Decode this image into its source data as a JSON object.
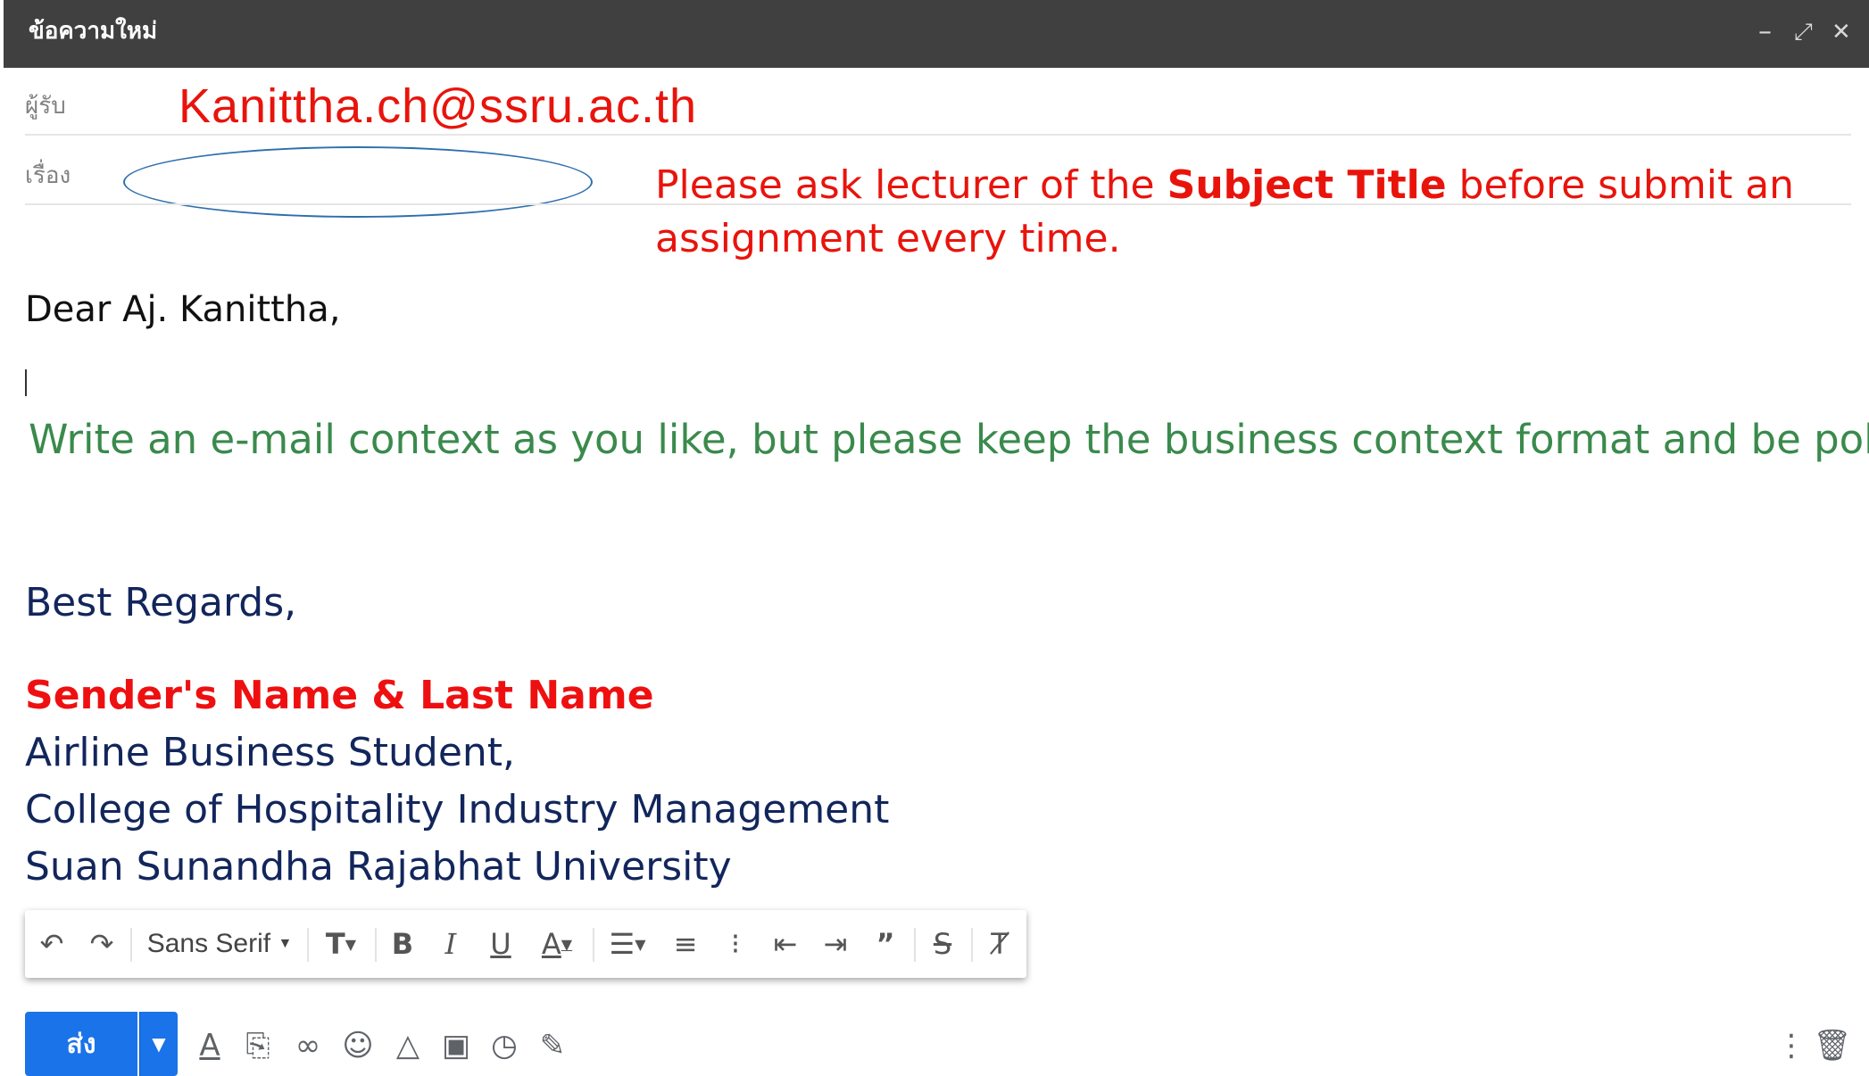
{
  "window": {
    "title": "ข้อความใหม่",
    "minimize_glyph": "–",
    "expand_glyph": "⤢",
    "close_glyph": "✕"
  },
  "fields": {
    "to_label": "ผู้รับ",
    "to_value": "Kanittha.ch@ssru.ac.th",
    "subject_label": "เรื่อง",
    "subject_value": ""
  },
  "instruction": {
    "part1": "Please ask lecturer of the ",
    "bold": "Subject Title",
    "part2": " before submit an assignment every time."
  },
  "body": {
    "salutation": "Dear Aj. Kanittha,",
    "note": "Write an e-mail context as you like, but please keep the business context format and be polite.",
    "closing": "Best Regards,",
    "sender_name": "Sender's Name & Last Name",
    "sig_line1": "Airline Business Student,",
    "sig_line2": "College of Hospitality Industry Management",
    "sig_line3": "Suan Sunandha Rajabhat University"
  },
  "format_toolbar": {
    "font_name": "Sans Serif",
    "icons": [
      "undo-icon",
      "redo-icon",
      "font-select",
      "text-size-icon",
      "bold-icon",
      "italic-icon",
      "underline-icon",
      "text-color-icon",
      "align-icon",
      "numbered-list-icon",
      "bulleted-list-icon",
      "indent-less-icon",
      "indent-more-icon",
      "quote-icon",
      "strikethrough-icon",
      "remove-formatting-icon"
    ]
  },
  "bottom_toolbar": {
    "send_label": "ส่ง",
    "icons": [
      "formatting-icon",
      "attach-icon",
      "link-icon",
      "emoji-icon",
      "drive-icon",
      "photo-icon",
      "confidential-icon",
      "signature-icon",
      "more-options-icon",
      "discard-icon"
    ]
  },
  "colors": {
    "titlebar": "#404040",
    "to_text": "#e8140c",
    "instruction_text": "#e8140c",
    "note_text": "#3a8a4c",
    "signature_text": "#12265c",
    "sender_name_text": "#ee1010",
    "send_button": "#1a73e8"
  }
}
